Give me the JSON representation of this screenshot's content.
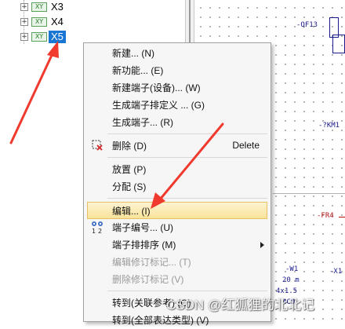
{
  "tree": {
    "items": [
      {
        "icon": "XY",
        "label": "X3",
        "expander": "+"
      },
      {
        "icon": "XY",
        "label": "X4",
        "expander": "+"
      },
      {
        "icon": "XY",
        "label": "X5",
        "expander": "+"
      }
    ]
  },
  "schematic": {
    "labels": {
      "qf13": "-QF13",
      "km1": "-?KM1",
      "fr4": "-FR4",
      "w1": "-W1",
      "w1_len": "20 m",
      "w1_spec": "4x1.5",
      "w1_code": "4C0",
      "x1": "-X1"
    },
    "colors": {
      "wire": "#1a1a8c",
      "fr": "#b01010"
    }
  },
  "menu": {
    "items": [
      {
        "label": "新建... (N)"
      },
      {
        "label": "新功能... (E)"
      },
      {
        "label": "新建端子(设备)... (W)"
      },
      {
        "label": "生成端子排定义 ... (G)"
      },
      {
        "label": "生成端子... (R)"
      },
      {
        "label": "删除 (D)",
        "shortcut": "Delete",
        "icon": "delete-icon"
      },
      {
        "label": "放置 (P)"
      },
      {
        "label": "分配 (S)"
      },
      {
        "label": "编辑... (I)",
        "highlighted": true
      },
      {
        "label": "端子编号... (U)",
        "icon": "terminal-numbering-icon"
      },
      {
        "label": "端子排排序 (M)",
        "submenu": true
      },
      {
        "label": "编辑修订标记... (T)",
        "disabled": true
      },
      {
        "label": "删除修订标记 (V)",
        "disabled": true
      },
      {
        "label": "转到(关联参考) (O)"
      },
      {
        "label": "转到(全部表达类型) (V)"
      }
    ],
    "highlight_colors": {
      "top": "#fdf3d1",
      "bottom": "#f9e39a",
      "border": "#e8c160"
    }
  },
  "annotation": {
    "arrow_color": "#f03a2e"
  },
  "watermark": "CSDN @红狐狸的北北记",
  "icons": {
    "tree_node": "xy-terminal-strip-icon",
    "expander": "plus-box-icon"
  }
}
